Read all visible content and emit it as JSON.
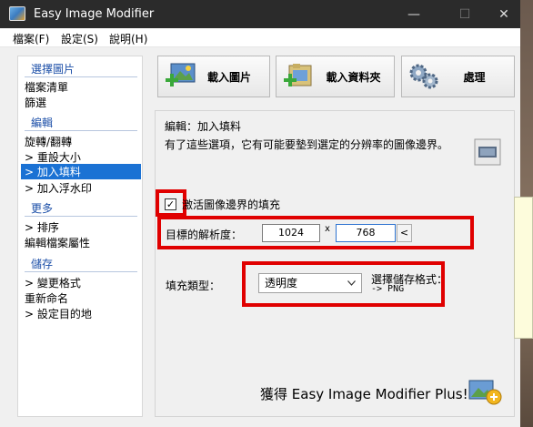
{
  "window": {
    "title": "Easy Image Modifier",
    "controls": {
      "minimize": "—",
      "maximize": "☐",
      "close": "✕"
    }
  },
  "menu": [
    "檔案(F)",
    "設定(S)",
    "說明(H)"
  ],
  "sidebar": {
    "select_images_header": "選擇圖片",
    "file_list": "檔案清單",
    "filter": "篩選",
    "edit_header": "編輯",
    "rotate_flip": "旋轉/翻轉",
    "resize": "> 重設大小",
    "add_padding": "> 加入填料",
    "add_watermark": "> 加入浮水印",
    "more_header": "更多",
    "sort": "> 排序",
    "edit_file_props": "編輯檔案屬性",
    "save_header": "儲存",
    "change_format": "> 變更格式",
    "rename": "重新命名",
    "set_destination": "> 設定目的地"
  },
  "toolbar": {
    "load_images": "載入圖片",
    "load_folder": "載入資料夾",
    "process": "處理"
  },
  "panel": {
    "heading": "編輯：加入填料",
    "description": "有了這些選項，它有可能要墊到選定的分辨率的圖像邊界。",
    "activate_checkbox_label": "激活圖像邊界的填充",
    "activate_checked": "✓",
    "target_resolution_label": "目標的解析度：",
    "width_value": "1024",
    "times": "x",
    "height_value": "768",
    "reset_arrow": "<",
    "fill_type_label": "填充類型：",
    "fill_type_value": "透明度",
    "save_format_hint_line1": "選擇儲存格式：",
    "save_format_hint_line2": "-> PNG"
  },
  "promo": "獲得 Easy Image Modifier Plus!",
  "colors": {
    "titlebar": "#2b2b2b",
    "selection": "#1b72d4",
    "highlight_red": "#e00000",
    "section_blue": "#1c4fa8"
  },
  "icons": {
    "app": "app-photo-icon",
    "load_images": "add-image-icon",
    "load_folder": "add-folder-icon",
    "process": "gears-icon",
    "preview": "image-preview-icon",
    "promo": "plus-badge-icon"
  }
}
